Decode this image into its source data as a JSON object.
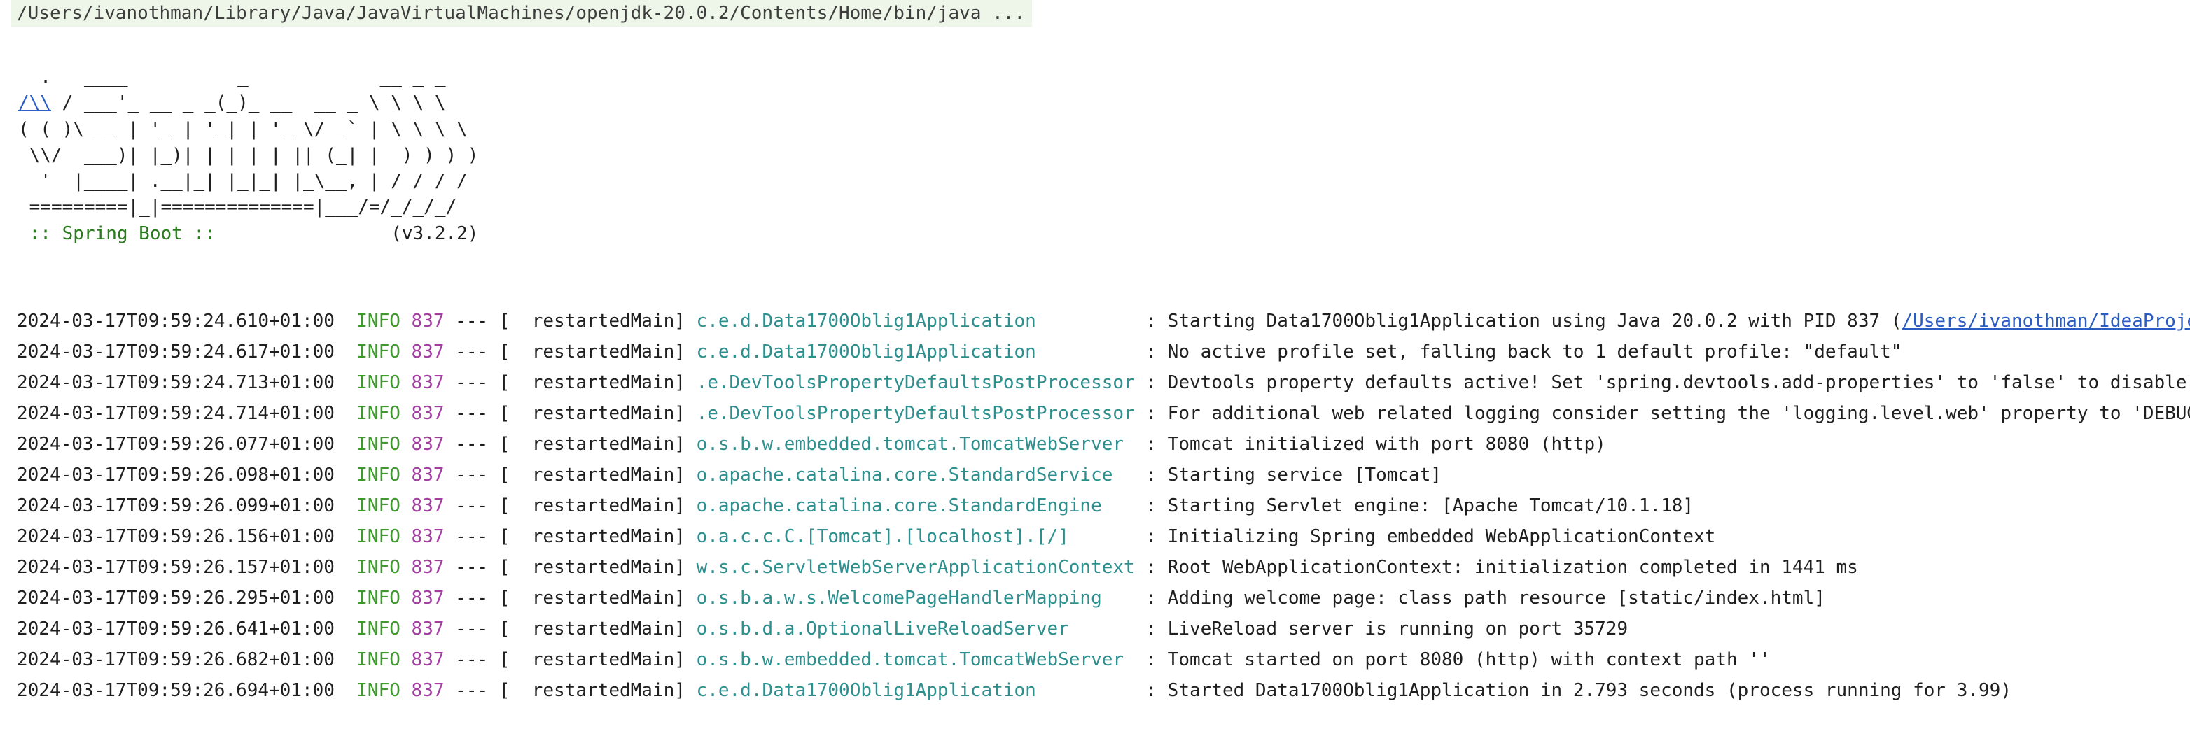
{
  "command": "/Users/ivanothman/Library/Java/JavaVirtualMachines/openjdk-20.0.2/Contents/Home/bin/java ...",
  "banner": {
    "line1": "  .   ____          _            __ _ _",
    "line2_link": "/\\\\",
    "line2_rest": " / ___'_ __ _ _(_)_ __  __ _ \\ \\ \\ \\",
    "line3": "( ( )\\___ | '_ | '_| | '_ \\/ _` | \\ \\ \\ \\",
    "line4": " \\\\/  ___)| |_)| | | | | || (_| |  ) ) ) )",
    "line5": "  '  |____| .__|_| |_|_| |_\\__, | / / / /",
    "line6": " =========|_|==============|___/=/_/_/_/",
    "spring_label": " :: Spring Boot ::",
    "version": "                (v3.2.2)"
  },
  "logs": [
    {
      "timestamp": "2024-03-17T09:59:24.610+01:00",
      "level": "INFO",
      "pid": "837",
      "thread": "restartedMain",
      "logger": "c.e.d.Data1700Oblig1Application",
      "message": "Starting Data1700Oblig1Application using Java 20.0.2 with PID 837 (",
      "message_link": "/Users/ivanothman/IdeaProje"
    },
    {
      "timestamp": "2024-03-17T09:59:24.617+01:00",
      "level": "INFO",
      "pid": "837",
      "thread": "restartedMain",
      "logger": "c.e.d.Data1700Oblig1Application",
      "message": "No active profile set, falling back to 1 default profile: \"default\"",
      "message_link": ""
    },
    {
      "timestamp": "2024-03-17T09:59:24.713+01:00",
      "level": "INFO",
      "pid": "837",
      "thread": "restartedMain",
      "logger": ".e.DevToolsPropertyDefaultsPostProcessor",
      "message": "Devtools property defaults active! Set 'spring.devtools.add-properties' to 'false' to disable",
      "message_link": ""
    },
    {
      "timestamp": "2024-03-17T09:59:24.714+01:00",
      "level": "INFO",
      "pid": "837",
      "thread": "restartedMain",
      "logger": ".e.DevToolsPropertyDefaultsPostProcessor",
      "message": "For additional web related logging consider setting the 'logging.level.web' property to 'DEBUG",
      "message_link": ""
    },
    {
      "timestamp": "2024-03-17T09:59:26.077+01:00",
      "level": "INFO",
      "pid": "837",
      "thread": "restartedMain",
      "logger": "o.s.b.w.embedded.tomcat.TomcatWebServer",
      "message": "Tomcat initialized with port 8080 (http)",
      "message_link": ""
    },
    {
      "timestamp": "2024-03-17T09:59:26.098+01:00",
      "level": "INFO",
      "pid": "837",
      "thread": "restartedMain",
      "logger": "o.apache.catalina.core.StandardService",
      "message": "Starting service [Tomcat]",
      "message_link": ""
    },
    {
      "timestamp": "2024-03-17T09:59:26.099+01:00",
      "level": "INFO",
      "pid": "837",
      "thread": "restartedMain",
      "logger": "o.apache.catalina.core.StandardEngine",
      "message": "Starting Servlet engine: [Apache Tomcat/10.1.18]",
      "message_link": ""
    },
    {
      "timestamp": "2024-03-17T09:59:26.156+01:00",
      "level": "INFO",
      "pid": "837",
      "thread": "restartedMain",
      "logger": "o.a.c.c.C.[Tomcat].[localhost].[/]",
      "message": "Initializing Spring embedded WebApplicationContext",
      "message_link": ""
    },
    {
      "timestamp": "2024-03-17T09:59:26.157+01:00",
      "level": "INFO",
      "pid": "837",
      "thread": "restartedMain",
      "logger": "w.s.c.ServletWebServerApplicationContext",
      "message": "Root WebApplicationContext: initialization completed in 1441 ms",
      "message_link": ""
    },
    {
      "timestamp": "2024-03-17T09:59:26.295+01:00",
      "level": "INFO",
      "pid": "837",
      "thread": "restartedMain",
      "logger": "o.s.b.a.w.s.WelcomePageHandlerMapping",
      "message": "Adding welcome page: class path resource [static/index.html]",
      "message_link": ""
    },
    {
      "timestamp": "2024-03-17T09:59:26.641+01:00",
      "level": "INFO",
      "pid": "837",
      "thread": "restartedMain",
      "logger": "o.s.b.d.a.OptionalLiveReloadServer",
      "message": "LiveReload server is running on port 35729",
      "message_link": ""
    },
    {
      "timestamp": "2024-03-17T09:59:26.682+01:00",
      "level": "INFO",
      "pid": "837",
      "thread": "restartedMain",
      "logger": "o.s.b.w.embedded.tomcat.TomcatWebServer",
      "message": "Tomcat started on port 8080 (http) with context path ''",
      "message_link": ""
    },
    {
      "timestamp": "2024-03-17T09:59:26.694+01:00",
      "level": "INFO",
      "pid": "837",
      "thread": "restartedMain",
      "logger": "c.e.d.Data1700Oblig1Application",
      "message": "Started Data1700Oblig1Application in 2.793 seconds (process running for 3.99)",
      "message_link": ""
    }
  ]
}
